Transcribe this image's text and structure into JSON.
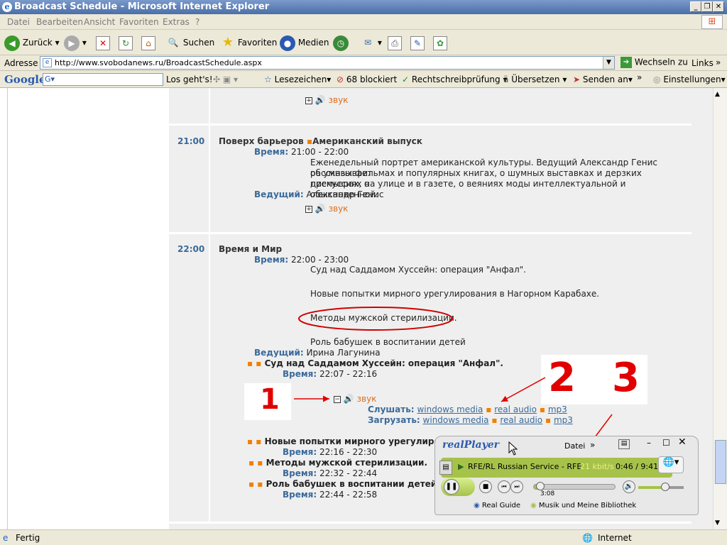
{
  "window": {
    "title": "Broadcast Schedule - Microsoft Internet Explorer"
  },
  "menu": [
    "Datei",
    "Bearbeiten",
    "Ansicht",
    "Favoriten",
    "Extras",
    "?"
  ],
  "toolbar": {
    "back": "Zurück",
    "search": "Suchen",
    "favorites": "Favoriten",
    "media": "Medien"
  },
  "address": {
    "label": "Adresse",
    "url": "http://www.svobodanews.ru/BroadcastSchedule.aspx",
    "go": "Wechseln zu",
    "links": "Links"
  },
  "google": {
    "logo": "Google",
    "search_btn": "Los geht's!",
    "bookmarks": "Lesezeichen",
    "blocked": "68 blockiert",
    "spell": "Rechtschreibprüfung",
    "translate": "Übersetzen",
    "send": "Senden an",
    "settings": "Einstellungen"
  },
  "schedule": {
    "sound": "звук",
    "time_label": "Время:",
    "host_label": "Ведущий:",
    "listen_label": "Слушать:",
    "download_label": "Загрузать:",
    "links": [
      "windows media",
      "real audio",
      "mp3"
    ],
    "p1": {
      "time": "21:00",
      "title": "Поверх барьеров",
      "subtitle": "Американский выпуск",
      "range": "21:00 - 22:00",
      "desc1": "Еженедельный портрет американской культуры. Ведущий Александр Генис рассказывает",
      "desc2": "об умных фильмах и популярных книгах, о шумных выставках и дерзких премьерах, о",
      "desc3": "дискуссиях на улице и в газете, о веяниях моды интеллектуальной и обыкновенной.",
      "host": "Александр Генис"
    },
    "p2": {
      "time": "22:00",
      "title": "Время и Мир",
      "range": "22:00 - 23:00",
      "topic1": "Суд над Саддамом Хуссейн: операция \"Анфал\".",
      "topic2": "Новые попытки мирного урегулирования в Нагорном Карабахе.",
      "topic3": "Методы мужской стерилизации.",
      "topic4": "Роль бабушек в воспитании детей",
      "host": "Ирина Лагунина",
      "sub1_title": "Суд над Саддамом Хуссейн: операция \"Анфал\".",
      "sub1_range": "22:07 - 22:16",
      "sub2_title": "Новые попытки мирного урегулирования в",
      "sub2_range": "22:16 - 22:30",
      "sub3_title": "Методы мужской стерилизации.",
      "sub3_range": "22:32 - 22:44",
      "sub4_title": "Роль бабушек в воспитании детей",
      "sub4_range": "22:44 - 22:58"
    }
  },
  "annotations": {
    "n1": "1",
    "n2": "2",
    "n3": "3"
  },
  "realplayer": {
    "logo": "realPlayer",
    "menu": "Datei",
    "station": "RFE/RL Russian Service - RFE",
    "bitrate": "21 kbit/s",
    "time": "0:46 / 9:41",
    "seek_time": "3:08",
    "progress": 0.08,
    "volume": 0.6,
    "guide": "Real Guide",
    "library": "Musik und Meine Bibliothek"
  },
  "status": {
    "text": "Fertig",
    "zone": "Internet"
  }
}
